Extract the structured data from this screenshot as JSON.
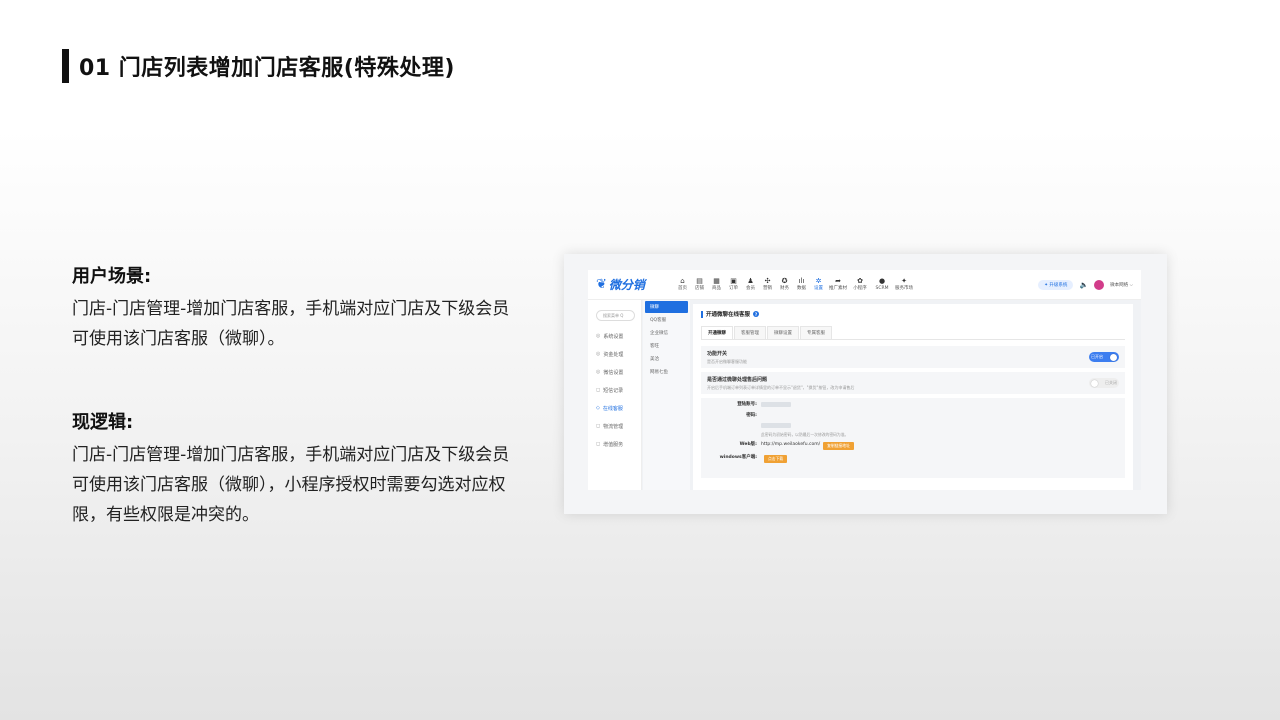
{
  "slide": {
    "title": "01 门店列表增加门店客服(特殊处理)"
  },
  "blocks": [
    {
      "heading": "用户场景:",
      "body": "门店-门店管理-增加门店客服，手机端对应门店及下级会员可使用该门店客服（微聊）。"
    },
    {
      "heading": "现逻辑:",
      "body": "门店-门店管理-增加门店客服，手机端对应门店及下级会员可使用该门店客服（微聊），小程序授权时需要勾选对应权限，有些权限是冲突的。"
    }
  ],
  "app": {
    "logo_text": "微分销",
    "nav": [
      {
        "glyph": "⌂",
        "label": "首页"
      },
      {
        "glyph": "▤",
        "label": "店铺"
      },
      {
        "glyph": "▦",
        "label": "商品"
      },
      {
        "glyph": "▣",
        "label": "订单"
      },
      {
        "glyph": "♟",
        "label": "会员"
      },
      {
        "glyph": "✣",
        "label": "营销"
      },
      {
        "glyph": "✪",
        "label": "财务"
      },
      {
        "glyph": "ılı",
        "label": "数据"
      },
      {
        "glyph": "✲",
        "label": "设置"
      },
      {
        "glyph": "➦",
        "label": "推广素材"
      },
      {
        "glyph": "✿",
        "label": "小程序"
      },
      {
        "glyph": "●",
        "label": "SCRM"
      },
      {
        "glyph": "✦",
        "label": "服务市场"
      }
    ],
    "upgrade_label": "✦ 升级系统",
    "user_name": "微本网络 ⌵",
    "search_placeholder": "搜索菜单 Q",
    "side_items": [
      {
        "icon": "◎",
        "label": "系统设置"
      },
      {
        "icon": "◎",
        "label": "资金处理"
      },
      {
        "icon": "◎",
        "label": "微信设置"
      },
      {
        "icon": "◻",
        "label": "短信记录"
      },
      {
        "icon": "◇",
        "label": "在线客服"
      },
      {
        "icon": "◻",
        "label": "物流管理"
      },
      {
        "icon": "◻",
        "label": "增值服务"
      }
    ],
    "sub_items": [
      "微聊",
      "QQ客服",
      "企业微信",
      "客旺",
      "美洽",
      "网易七鱼"
    ],
    "content_title": "开通微聊在线客服",
    "tabs": [
      "开通微聊",
      "客服管理",
      "微聊设置",
      "专属客服"
    ],
    "settings": [
      {
        "title": "功能开关",
        "desc": "是否开启微聊客服功能",
        "toggle": "已开启"
      },
      {
        "title": "是否通过微聊处理售后问题",
        "desc": "开启后手机端订单列表订单详情里的订单不显示\"退货\"，\"换货\"按钮，改为申请售后",
        "toggle": "已关闭"
      }
    ],
    "form": {
      "account_label": "登陆账号:",
      "password_label": "密码:",
      "password_hint": "此密码为初始密码，以防最后一次修改的密码为准。",
      "web_label": "Web版:",
      "web_url": "http://mp.weilaokefu.com/",
      "web_btn": "复制链接地址",
      "windows_label": "windows客户端:",
      "windows_btn": "点击下载"
    }
  }
}
